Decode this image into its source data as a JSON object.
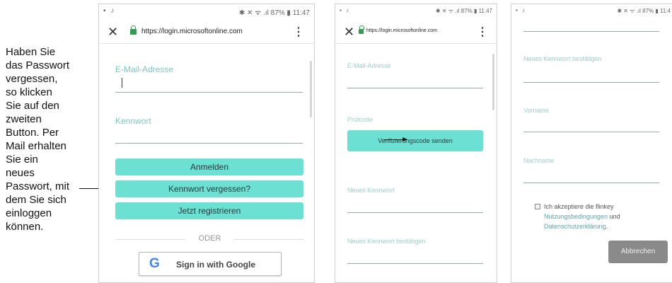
{
  "caption": {
    "lines": [
      "Haben Sie",
      "das Passwort",
      "vergessen,",
      "so klicken",
      "Sie auf den",
      "zweiten",
      "Button. Per",
      "Mail erhalten",
      "Sie ein",
      "neues",
      "Passwort, mit",
      "dem Sie sich",
      "einloggen",
      "können."
    ]
  },
  "status_bar": {
    "left": "▪ ♪",
    "right_full": "✱ ✕ ᯤ .ıl 87% ▮ 11:47",
    "right_cut": "✱ ✕ ᯤ .ıl 87% ▮ 11:4"
  },
  "browser": {
    "url": "https://login.microsoftonline.com",
    "close_glyph": "✕",
    "menu_glyph": "⋮"
  },
  "screen1": {
    "email_label": "E-Mail-Adresse",
    "password_label": "Kennwort",
    "login_button": "Anmelden",
    "forgot_button": "Kennwort vergessen?",
    "register_button": "Jetzt registrieren",
    "divider_text": "ODER",
    "google_logo": "G",
    "google_button": "Sign in with Google"
  },
  "screen2": {
    "email_label": "E-Mail-Adresse",
    "code_label": "Prüfcode",
    "verify_button": "Verifizierungscode senden",
    "new_password_label": "Neues Kennwort",
    "confirm_password_label": "Neues Kennwort bestätigen"
  },
  "screen3": {
    "confirm_password_label": "Neues Kennwort bestätigen",
    "firstname_label": "Vorname",
    "lastname_label": "Nachname",
    "terms_text": "Ich akzeptiere die flinkey",
    "terms_link": "Nutzungsbedingungen",
    "terms_and": "und",
    "privacy_link": "Datenschutzerklärung",
    "cancel_button": "Abbrechen"
  }
}
